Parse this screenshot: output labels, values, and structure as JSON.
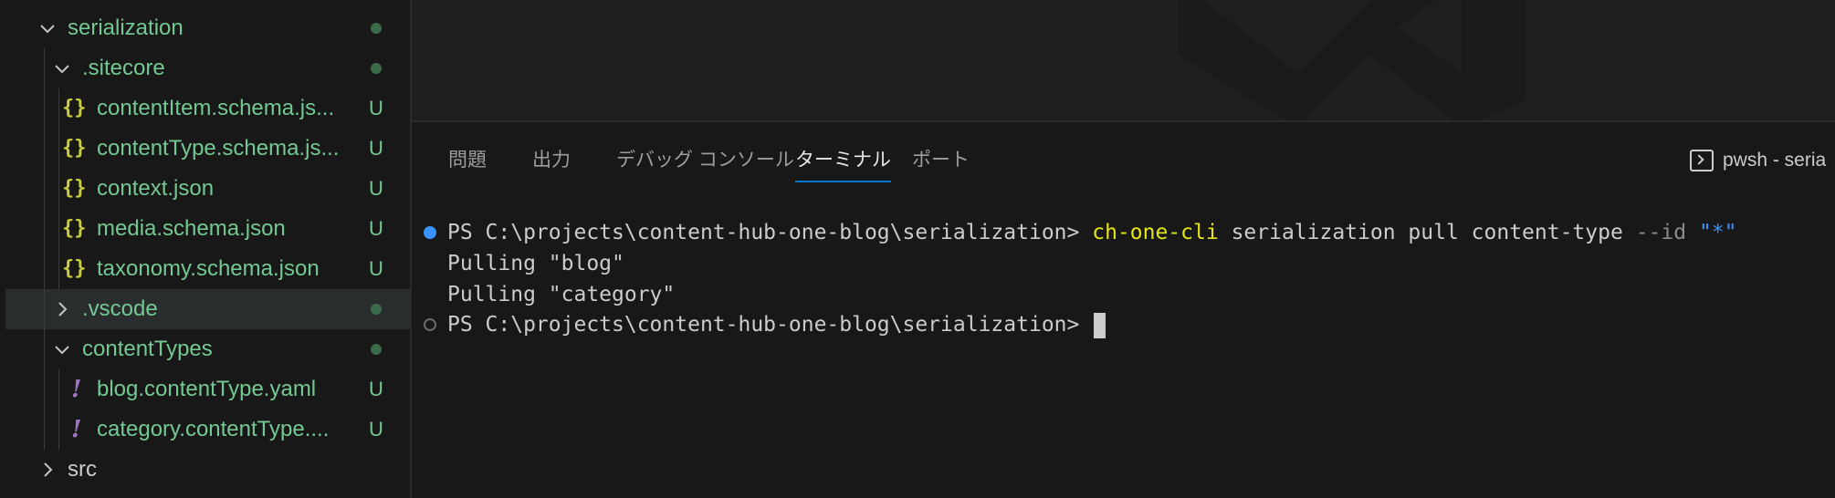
{
  "explorer": {
    "items": [
      {
        "label": "serialization",
        "kind": "folder-open",
        "status": "dot"
      },
      {
        "label": ".sitecore",
        "kind": "folder-open",
        "status": "dot"
      },
      {
        "label": "contentItem.schema.js...",
        "kind": "json",
        "status": "U"
      },
      {
        "label": "contentType.schema.js...",
        "kind": "json",
        "status": "U"
      },
      {
        "label": "context.json",
        "kind": "json",
        "status": "U"
      },
      {
        "label": "media.schema.json",
        "kind": "json",
        "status": "U"
      },
      {
        "label": "taxonomy.schema.json",
        "kind": "json",
        "status": "U"
      },
      {
        "label": ".vscode",
        "kind": "folder-closed",
        "status": "dot",
        "selected": true
      },
      {
        "label": "contentTypes",
        "kind": "folder-open",
        "status": "dot"
      },
      {
        "label": "blog.contentType.yaml",
        "kind": "yaml",
        "status": "U"
      },
      {
        "label": "category.contentType....",
        "kind": "yaml",
        "status": "U"
      },
      {
        "label": "src",
        "kind": "folder-closed",
        "status": ""
      }
    ],
    "icons": {
      "json": "{}",
      "yaml": "!"
    },
    "status_untracked": "U"
  },
  "panel": {
    "tabs": [
      {
        "label": "問題",
        "active": false
      },
      {
        "label": "出力",
        "active": false
      },
      {
        "label": "デバッグ コンソール",
        "active": false
      },
      {
        "label": "ターミナル",
        "active": true
      },
      {
        "label": "ポート",
        "active": false
      }
    ],
    "terminal_selector": "pwsh - seria"
  },
  "terminal": {
    "prompt": "PS C:\\projects\\content-hub-one-blog\\serialization>",
    "command": {
      "program": "ch-one-cli",
      "args": "serialization pull content-type",
      "flag": "--id",
      "value": "\"*\""
    },
    "output": [
      "Pulling \"blog\"",
      "Pulling \"category\""
    ],
    "prompt2": "PS C:\\projects\\content-hub-one-blog\\serialization>"
  },
  "colors": {
    "git_untracked": "#73c991",
    "json_icon": "#cbcb41",
    "yaml_icon": "#a074c4",
    "active_tab_underline": "#0078d4",
    "command": "#e5e510",
    "string": "#3794ff"
  }
}
